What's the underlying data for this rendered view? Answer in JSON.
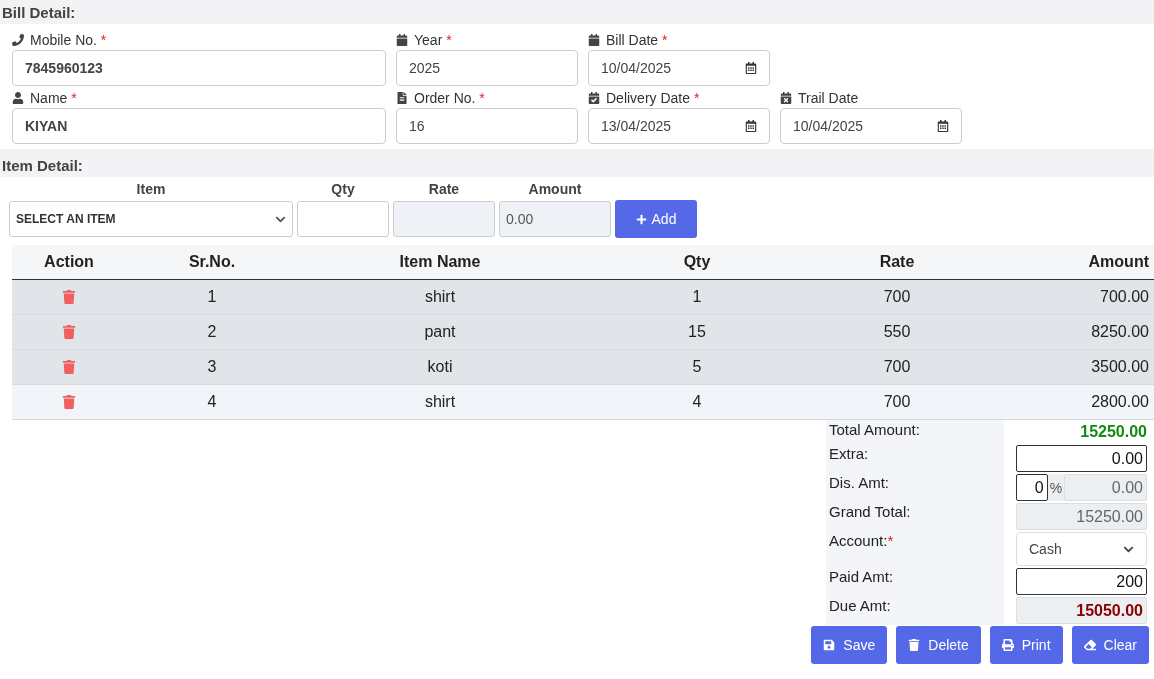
{
  "bill_detail": {
    "title": "Bill Detail:",
    "rows": [
      [
        {
          "label": "Mobile No.",
          "mark": "*",
          "kind": "text",
          "value": "7845960123",
          "bold": true
        },
        {
          "label": "Year",
          "mark": "*",
          "kind": "text",
          "value": "2025",
          "bold": false
        },
        {
          "label": "Bill Date",
          "mark": "*",
          "kind": "date",
          "value": "10/04/2025",
          "bold": false
        }
      ],
      [
        {
          "label": "Name",
          "mark": "*",
          "kind": "text",
          "value": "KIYAN",
          "bold": true
        },
        {
          "label": "Order No.",
          "mark": "*",
          "kind": "text",
          "value": "16",
          "bold": false
        },
        {
          "label": "Delivery Date",
          "mark": "*",
          "kind": "date",
          "value": "13/04/2025",
          "bold": false
        },
        {
          "label": "Trail Date",
          "kind": "date",
          "value": "10/04/2025",
          "bold": false
        }
      ]
    ]
  },
  "item_detail": {
    "title": "Item Detail:",
    "item": {
      "label": "Item",
      "value": "SELECT AN ITEM"
    },
    "qty": {
      "label": "Qty"
    },
    "rate": {
      "label": "Rate"
    },
    "amount": {
      "label": "Amount",
      "value": "0.00"
    },
    "add_button": "Add"
  },
  "table": {
    "columns": [
      "Action",
      "Sr.No.",
      "Item Name",
      "Qty",
      "Rate",
      "Amount"
    ],
    "rows": [
      {
        "sr": "1",
        "item": "shirt",
        "qty": "1",
        "rate": "700",
        "amount": "700.00",
        "highlighted": true
      },
      {
        "sr": "2",
        "item": "pant",
        "qty": "15",
        "rate": "550",
        "amount": "8250.00",
        "highlighted": true
      },
      {
        "sr": "3",
        "item": "koti",
        "qty": "5",
        "rate": "700",
        "amount": "3500.00",
        "highlighted": true
      },
      {
        "sr": "4",
        "item": "shirt",
        "qty": "4",
        "rate": "700",
        "amount": "2800.00",
        "highlighted": false
      }
    ]
  },
  "summary": [
    {
      "kind": "total",
      "label": "Total Amount:",
      "value": "15250.00"
    },
    {
      "kind": "input",
      "label": "Extra:",
      "value": "0.00"
    },
    {
      "kind": "discount",
      "label": "Dis. Amt:",
      "percent": "0",
      "percent_sign": "%",
      "value": "0.00"
    },
    {
      "kind": "readonly",
      "label": "Grand Total:",
      "value": "15250.00"
    },
    {
      "kind": "select",
      "label": "Account:",
      "mark": "*",
      "value": "Cash"
    },
    {
      "kind": "input",
      "label": "Paid Amt:",
      "value": "200"
    },
    {
      "kind": "due",
      "label": "Due Amt:",
      "value": "15050.00"
    }
  ],
  "buttons": [
    "Save",
    "Delete",
    "Print",
    "Clear"
  ]
}
